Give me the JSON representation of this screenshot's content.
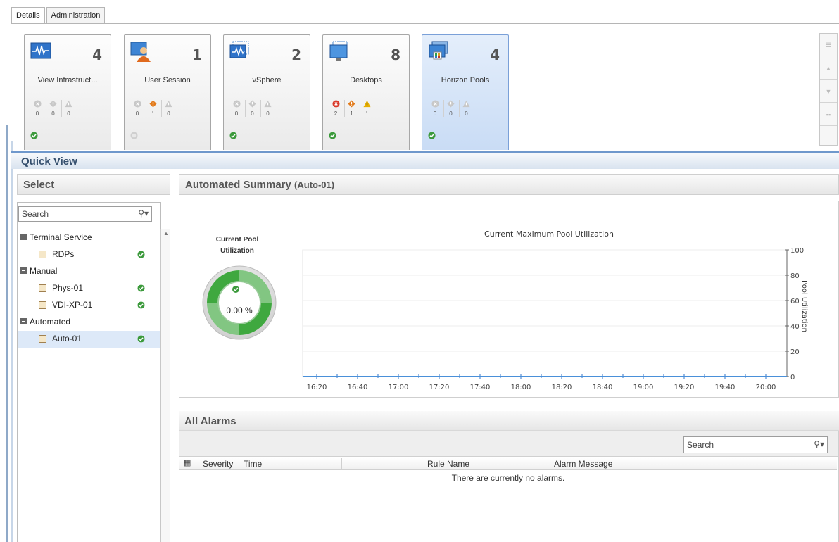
{
  "tabs": [
    {
      "label": "Details"
    },
    {
      "label": "Administration"
    }
  ],
  "tiles": [
    {
      "name": "View Infrastruct...",
      "count": "4",
      "icon": "infrastructure-monitor-icon",
      "stats": [
        "0",
        "0",
        "0"
      ],
      "status": "ok"
    },
    {
      "name": "User Session",
      "count": "1",
      "icon": "user-session-icon",
      "stats": [
        "0",
        "1",
        "0"
      ],
      "status": "unknown"
    },
    {
      "name": "vSphere",
      "count": "2",
      "icon": "vsphere-icon",
      "stats": [
        "0",
        "0",
        "0"
      ],
      "status": "ok"
    },
    {
      "name": "Desktops",
      "count": "8",
      "icon": "desktops-icon",
      "stats": [
        "2",
        "1",
        "1"
      ],
      "status": "ok"
    },
    {
      "name": "Horizon Pools",
      "count": "4",
      "icon": "horizon-pools-icon",
      "stats": [
        "0",
        "0",
        "0"
      ],
      "status": "ok"
    }
  ],
  "quick_view": {
    "title": "Quick View"
  },
  "select_panel": {
    "title": "Select",
    "search_placeholder": "Search",
    "tree": [
      {
        "label": "Terminal Service",
        "type": "group"
      },
      {
        "label": "RDPs",
        "type": "item",
        "status": "ok"
      },
      {
        "label": "Manual",
        "type": "group"
      },
      {
        "label": "Phys-01",
        "type": "item",
        "status": "ok"
      },
      {
        "label": "VDI-XP-01",
        "type": "item",
        "status": "ok"
      },
      {
        "label": "Automated",
        "type": "group"
      },
      {
        "label": "Auto-01",
        "type": "item",
        "status": "ok",
        "selected": true
      }
    ]
  },
  "summary": {
    "title": "Automated Summary",
    "pool": "(Auto-01)",
    "gauge_label_line1": "Current Pool",
    "gauge_label_line2": "Utilization",
    "gauge_value": "0.00 %"
  },
  "chart_data": {
    "type": "line",
    "title": "Current Maximum Pool Utilization",
    "ylabel": "Pool Utilization",
    "x": [
      "16:20",
      "16:40",
      "17:00",
      "17:20",
      "17:40",
      "18:00",
      "18:20",
      "18:40",
      "19:00",
      "19:20",
      "19:40",
      "20:00"
    ],
    "y_ticks": [
      "0",
      "20",
      "40",
      "60",
      "80",
      "100"
    ],
    "ylim": [
      0,
      100
    ],
    "series": [
      {
        "values": [
          0,
          0,
          0,
          0,
          0,
          0,
          0,
          0,
          0,
          0,
          0,
          0
        ],
        "color": "#4a90d9"
      }
    ]
  },
  "alarms": {
    "title": "All Alarms",
    "search_placeholder": "Search",
    "columns": [
      "Severity",
      "Time",
      "Rule Name",
      "Alarm Message"
    ],
    "empty_text": "There are currently no alarms."
  },
  "colors": {
    "ok": "#3c9a3c",
    "error": "#d93a2b",
    "warning": "#e8b000",
    "major": "#e27a1a",
    "accent": "#6f98cc"
  }
}
